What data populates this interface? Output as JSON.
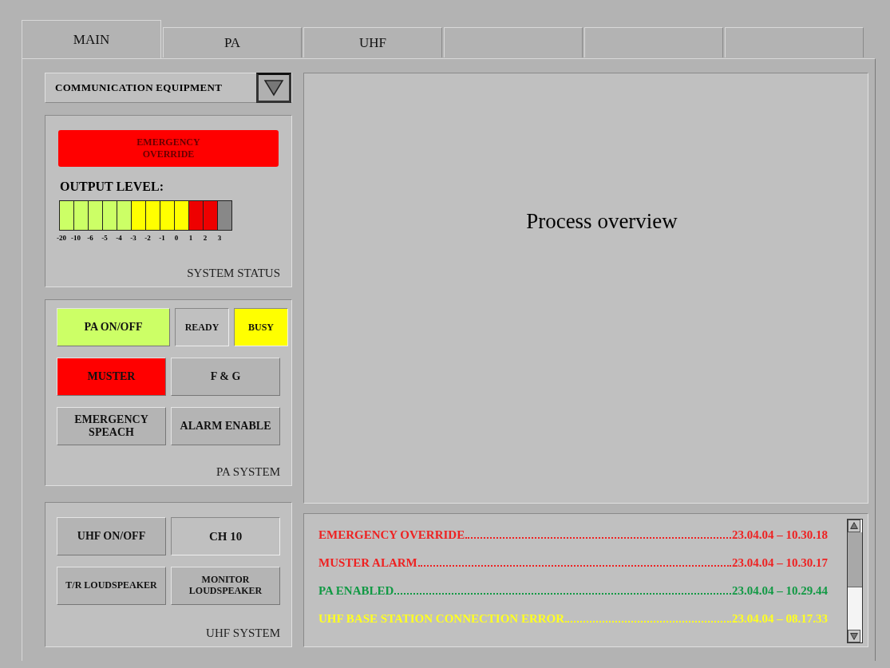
{
  "tabs": [
    {
      "label": "MAIN",
      "selected": true
    },
    {
      "label": "PA",
      "selected": false
    },
    {
      "label": "UHF",
      "selected": false
    },
    {
      "selected": false
    },
    {
      "selected": false
    },
    {
      "selected": false
    }
  ],
  "equipment_select": {
    "value": "COMMUNICATION EQUIPMENT"
  },
  "system_status": {
    "alarm": {
      "label": "EMERGENCY OVERRIDE",
      "color": "#ff0000"
    },
    "output_label": "OUTPUT LEVEL:",
    "meter": {
      "level": 0.917,
      "scale": [
        "-20",
        "-10",
        "-6",
        "-5",
        "-4",
        "-3",
        "-2",
        "-1",
        "0",
        "1",
        "2",
        "3"
      ]
    },
    "caption": "SYSTEM STATUS"
  },
  "pa_system": {
    "buttons": [
      {
        "label": "PA ON/OFF",
        "kind": "button",
        "color": "#ccff66"
      },
      {
        "label": "READY",
        "kind": "indicator",
        "color": "#c0c0c0"
      },
      {
        "label": "BUSY",
        "kind": "indicator",
        "color": "#ffff00"
      },
      {
        "label": "MUSTER",
        "kind": "button",
        "color": "#ff0000"
      },
      {
        "label": "F & G",
        "kind": "button",
        "color": "#b4b4b4"
      },
      {
        "label": "EMERGENCY SPEACH",
        "kind": "button",
        "color": "#b4b4b4"
      },
      {
        "label": "ALARM ENABLE",
        "kind": "button",
        "color": "#b4b4b4"
      }
    ],
    "caption": "PA SYSTEM"
  },
  "uhf_system": {
    "buttons": [
      {
        "label": "UHF ON/OFF",
        "kind": "button"
      },
      {
        "label": "CH 10",
        "kind": "display"
      },
      {
        "label": "T/R LOUDSPEAKER",
        "kind": "button"
      },
      {
        "label": "MONITOR LOUDSPEAKER",
        "kind": "button"
      }
    ],
    "caption": "UHF SYSTEM"
  },
  "overview": {
    "title": "Process overview"
  },
  "log": [
    {
      "message": "EMERGENCY OVERRIDE",
      "time": "23.04.04 – 10.30.18",
      "color": "#ee2222"
    },
    {
      "message": "MUSTER ALARM",
      "time": "23.04.04 – 10.30.17",
      "color": "#ee2222"
    },
    {
      "message": "PA ENABLED",
      "time": "23.04.04 – 10.29.44",
      "color": "#119944"
    },
    {
      "message": "UHF BASE STATION CONNECTION ERROR",
      "time": "23.04.04 – 08.17.33",
      "color": "#ffff22"
    }
  ]
}
